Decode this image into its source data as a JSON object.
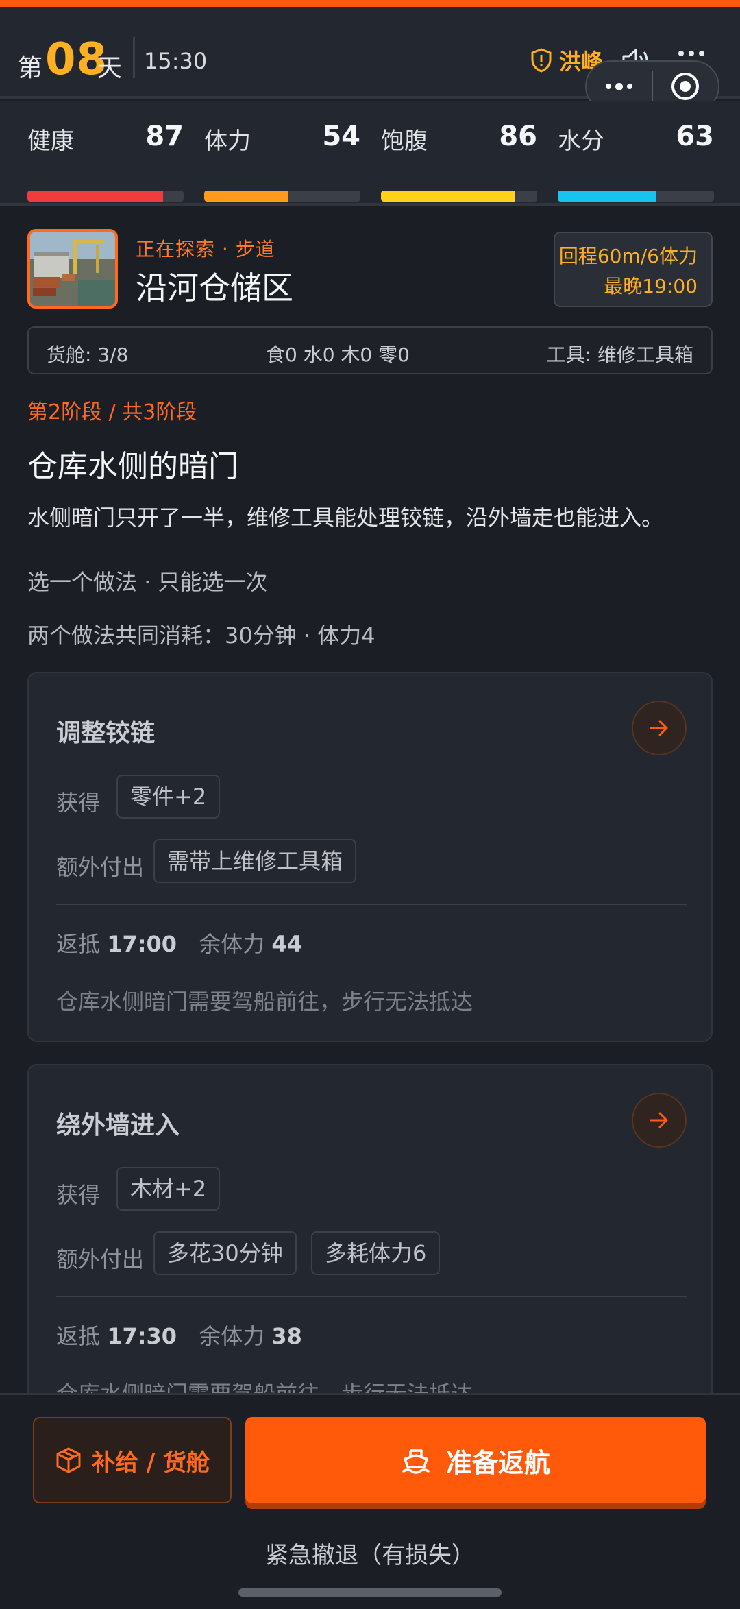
{
  "header": {
    "day_prefix": "第",
    "day_number": "08",
    "day_suffix": "天",
    "time": "15:30",
    "event_label": "洪峰"
  },
  "stats": [
    {
      "label": "健康",
      "value": 87,
      "max": 100,
      "color": "#f03c3c"
    },
    {
      "label": "体力",
      "value": 54,
      "max": 100,
      "color": "#ff9a1a"
    },
    {
      "label": "饱腹",
      "value": 86,
      "max": 100,
      "color": "#ffd21a"
    },
    {
      "label": "水分",
      "value": 63,
      "max": 100,
      "color": "#19c3f0"
    }
  ],
  "location": {
    "tag": "正在探索 · 步道",
    "name": "沿河仓储区",
    "return_info": "回程60m/6体力",
    "latest": "最晚19:00"
  },
  "cargo": {
    "hold": "货舱: 3/8",
    "resources": "食0 水0 木0 零0",
    "tool": "工具: 维修工具箱"
  },
  "event": {
    "stage": "第2阶段 / 共3阶段",
    "title": "仓库水侧的暗门",
    "description": "水侧暗门只开了一半，维修工具能处理铰链，沿外墙走也能进入。",
    "choose_hint": "选一个做法 · 只能选一次",
    "shared_cost": "两个做法共同消耗：30分钟 · 体力4"
  },
  "options": [
    {
      "title": "调整铰链",
      "gain_label": "获得",
      "gains": [
        "零件+2"
      ],
      "extra_label": "额外付出",
      "extras": [
        "需带上维修工具箱"
      ],
      "return_label": "返抵",
      "return_time": "17:00",
      "stamina_label": "余体力",
      "stamina_left": "44",
      "note": "仓库水侧暗门需要驾船前往，步行无法抵达"
    },
    {
      "title": "绕外墙进入",
      "gain_label": "获得",
      "gains": [
        "木材+2"
      ],
      "extra_label": "额外付出",
      "extras": [
        "多花30分钟",
        "多耗体力6"
      ],
      "return_label": "返抵",
      "return_time": "17:30",
      "stamina_label": "余体力",
      "stamina_left": "38",
      "note": "仓库水侧暗门需要驾船前往，步行无法抵达"
    }
  ],
  "actions": {
    "supply": "补给 / 货舱",
    "return": "准备返航",
    "retreat": "紧急撤退（有损失）"
  },
  "colors": {
    "accent": "#ff5a0a",
    "warning": "#ffb020"
  }
}
